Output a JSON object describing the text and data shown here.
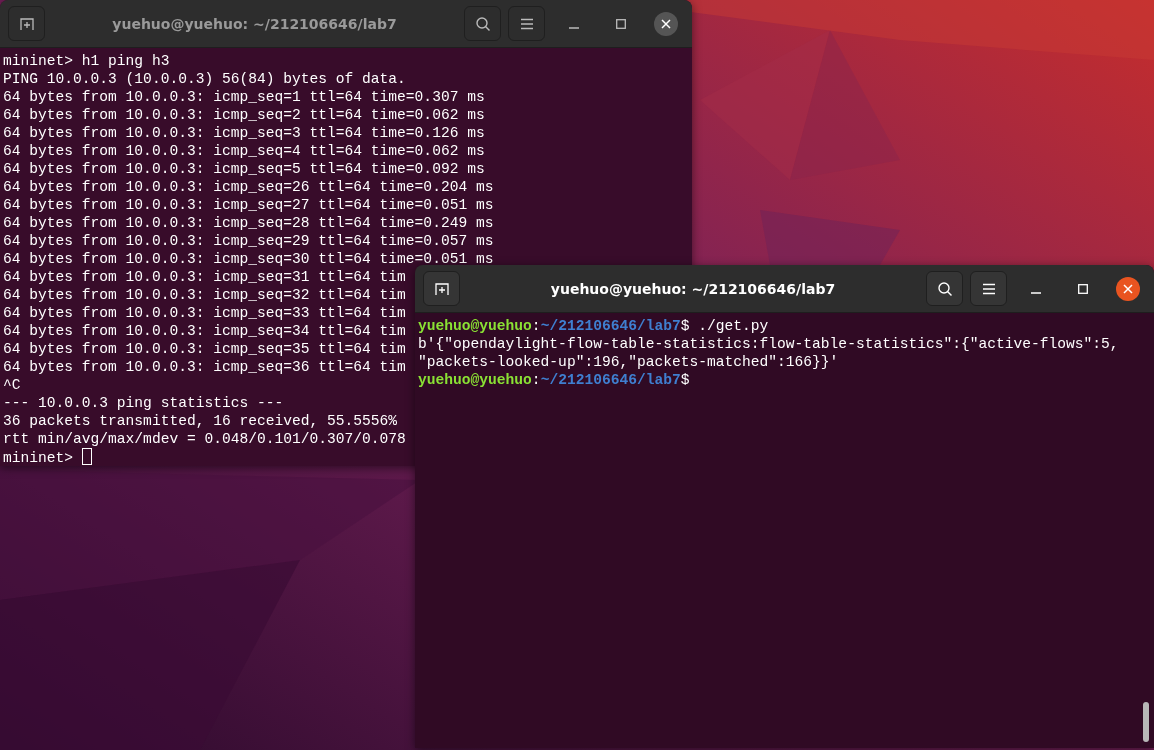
{
  "windows": [
    {
      "title": "yuehuo@yuehuo: ~/212106646/lab7",
      "focused": false,
      "cursor": true,
      "lines": [
        "mininet> h1 ping h3",
        "PING 10.0.0.3 (10.0.0.3) 56(84) bytes of data.",
        "64 bytes from 10.0.0.3: icmp_seq=1 ttl=64 time=0.307 ms",
        "64 bytes from 10.0.0.3: icmp_seq=2 ttl=64 time=0.062 ms",
        "64 bytes from 10.0.0.3: icmp_seq=3 ttl=64 time=0.126 ms",
        "64 bytes from 10.0.0.3: icmp_seq=4 ttl=64 time=0.062 ms",
        "64 bytes from 10.0.0.3: icmp_seq=5 ttl=64 time=0.092 ms",
        "64 bytes from 10.0.0.3: icmp_seq=26 ttl=64 time=0.204 ms",
        "64 bytes from 10.0.0.3: icmp_seq=27 ttl=64 time=0.051 ms",
        "64 bytes from 10.0.0.3: icmp_seq=28 ttl=64 time=0.249 ms",
        "64 bytes from 10.0.0.3: icmp_seq=29 ttl=64 time=0.057 ms",
        "64 bytes from 10.0.0.3: icmp_seq=30 ttl=64 time=0.051 ms",
        "64 bytes from 10.0.0.3: icmp_seq=31 ttl=64 tim",
        "64 bytes from 10.0.0.3: icmp_seq=32 ttl=64 tim",
        "64 bytes from 10.0.0.3: icmp_seq=33 ttl=64 tim",
        "64 bytes from 10.0.0.3: icmp_seq=34 ttl=64 tim",
        "64 bytes from 10.0.0.3: icmp_seq=35 ttl=64 tim",
        "64 bytes from 10.0.0.3: icmp_seq=36 ttl=64 tim",
        "^C",
        "--- 10.0.0.3 ping statistics ---",
        "36 packets transmitted, 16 received, 55.5556%",
        "rtt min/avg/max/mdev = 0.048/0.101/0.307/0.078",
        "mininet> "
      ]
    },
    {
      "title": "yuehuo@yuehuo: ~/212106646/lab7",
      "focused": true,
      "cursor": false,
      "lines": [
        [
          {
            "kind": "user",
            "text": "yuehuo@yuehuo"
          },
          {
            "kind": "text",
            "text": ":"
          },
          {
            "kind": "path",
            "text": "~/212106646/lab7"
          },
          {
            "kind": "text",
            "text": "$ ./get.py"
          }
        ],
        "b'{\"opendaylight-flow-table-statistics:flow-table-statistics\":{\"active-flows\":5,",
        "\"packets-looked-up\":196,\"packets-matched\":166}}'",
        [
          {
            "kind": "user",
            "text": "yuehuo@yuehuo"
          },
          {
            "kind": "text",
            "text": ":"
          },
          {
            "kind": "path",
            "text": "~/212106646/lab7"
          },
          {
            "kind": "text",
            "text": "$"
          }
        ]
      ]
    }
  ]
}
